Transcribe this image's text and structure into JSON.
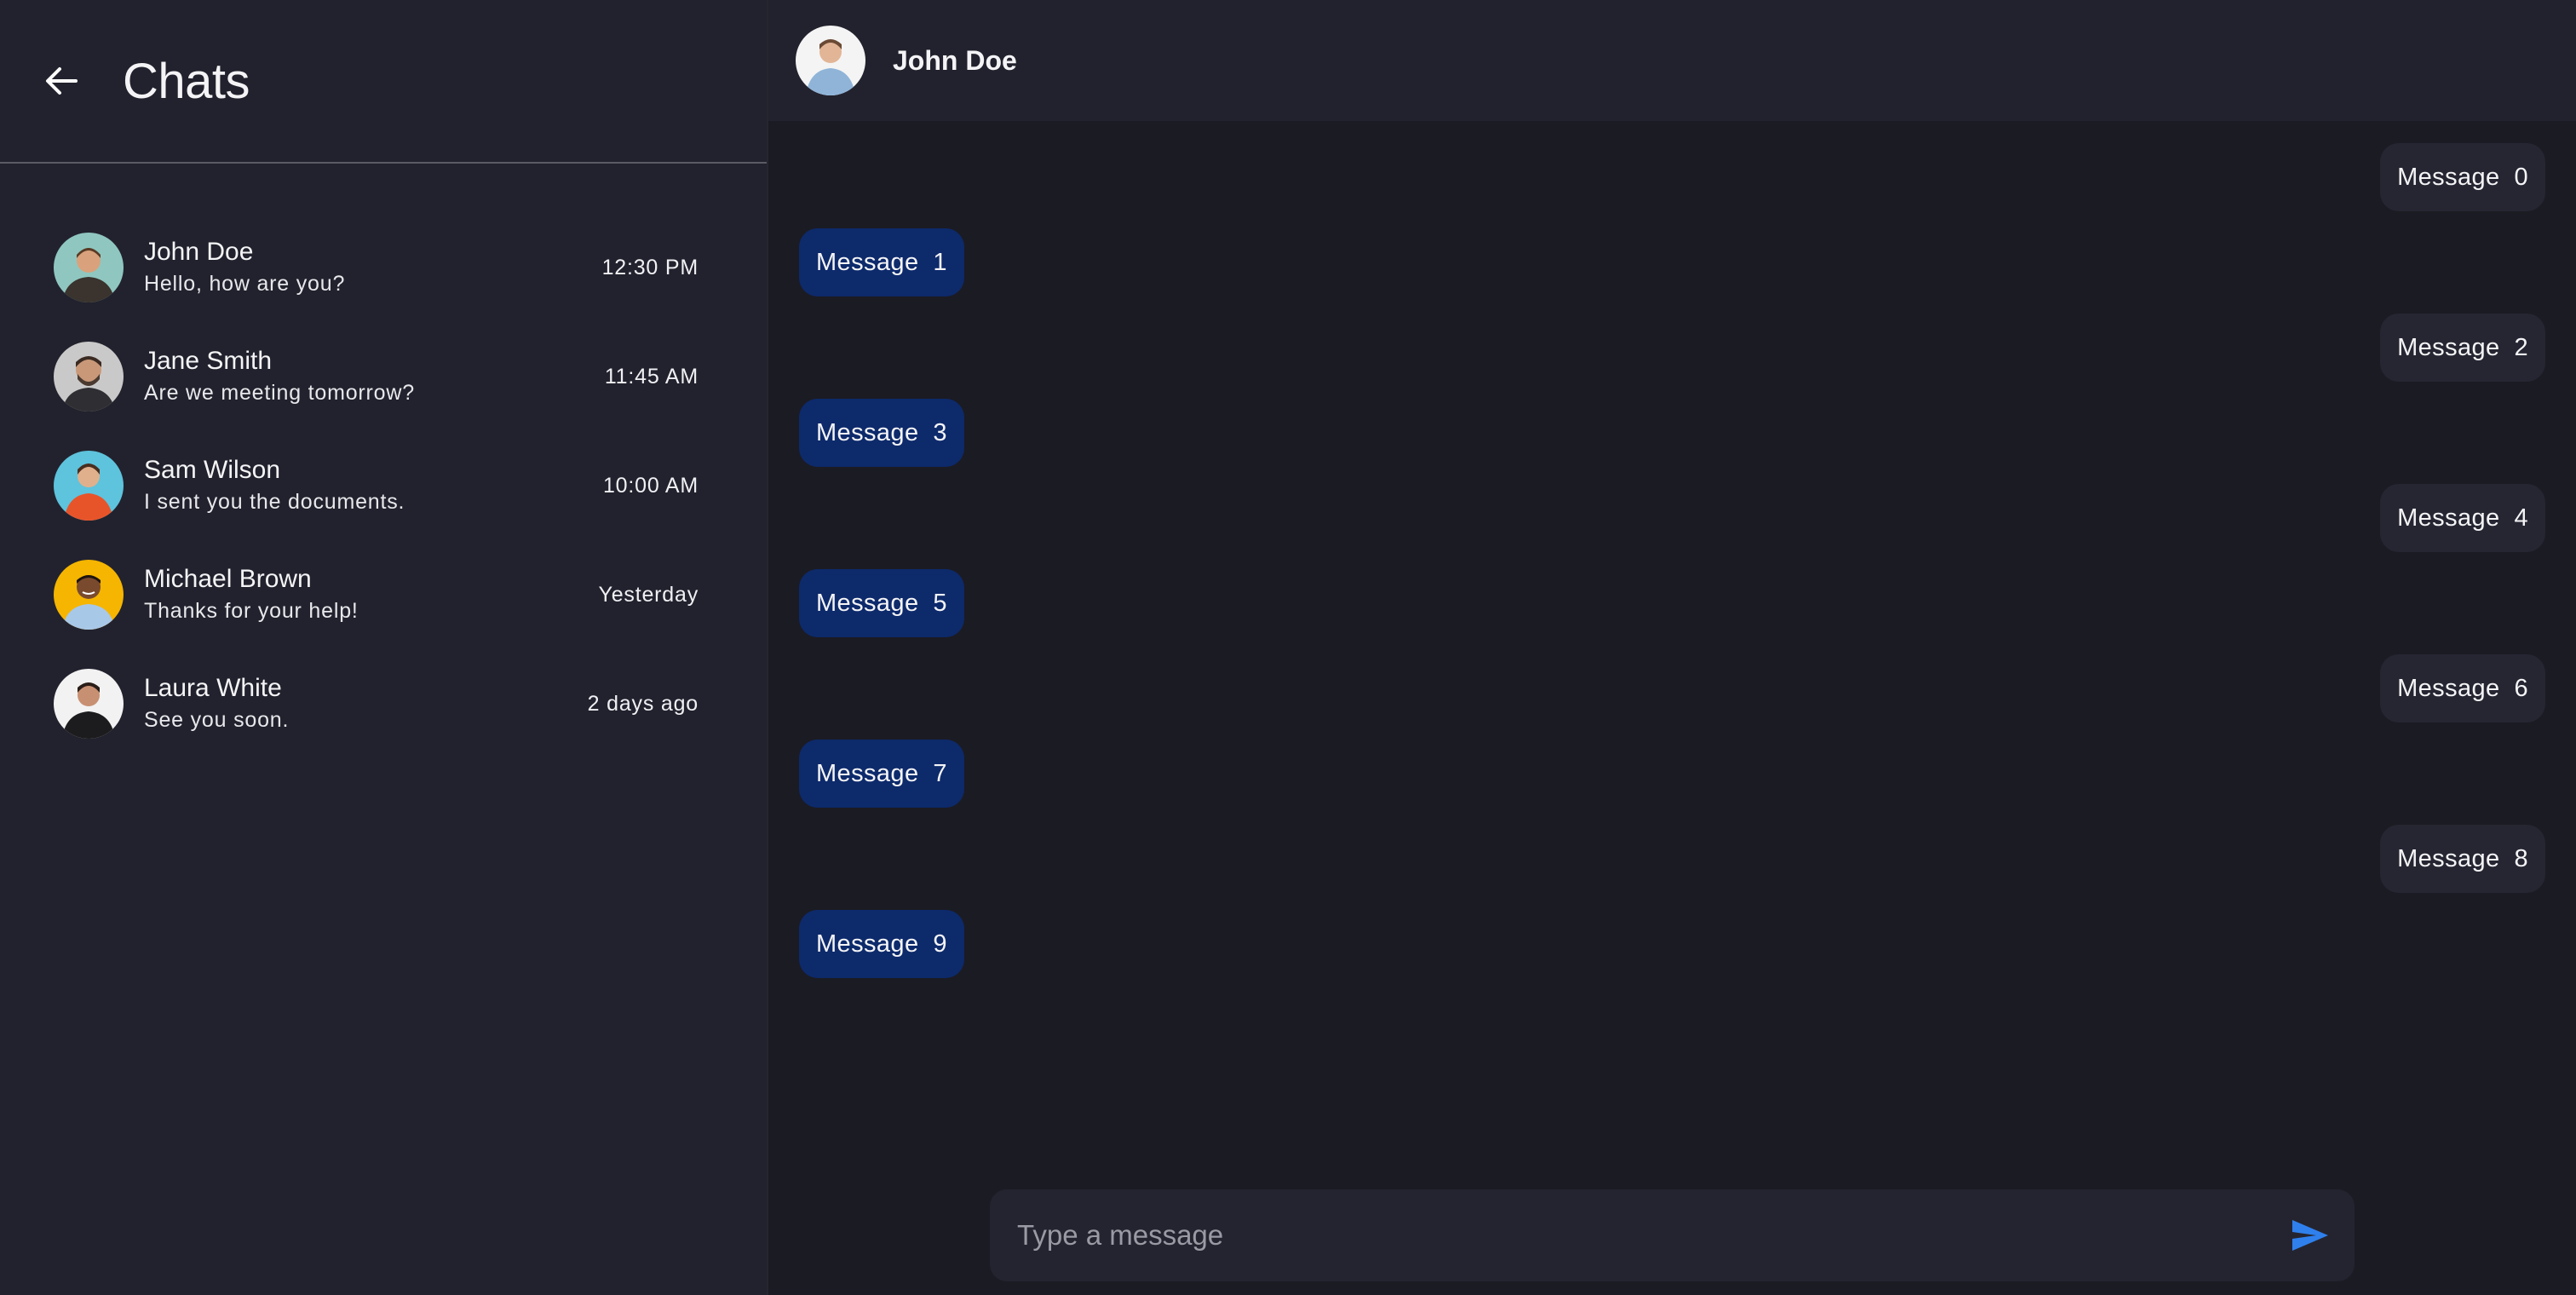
{
  "sidebar": {
    "title": "Chats",
    "chats": [
      {
        "name": "John Doe",
        "preview": "Hello, how are you?",
        "time": "12:30 PM"
      },
      {
        "name": "Jane Smith",
        "preview": "Are we meeting tomorrow?",
        "time": "11:45 AM"
      },
      {
        "name": "Sam Wilson",
        "preview": "I sent you the documents.",
        "time": "10:00 AM"
      },
      {
        "name": "Michael Brown",
        "preview": "Thanks for your help!",
        "time": "Yesterday"
      },
      {
        "name": "Laura White",
        "preview": "See you soon.",
        "time": "2 days ago"
      }
    ]
  },
  "conversation": {
    "contact_name": "John Doe",
    "messages": [
      {
        "text": "Message  0",
        "direction": "incoming"
      },
      {
        "text": "Message  1",
        "direction": "outgoing"
      },
      {
        "text": "Message  2",
        "direction": "incoming"
      },
      {
        "text": "Message  3",
        "direction": "outgoing"
      },
      {
        "text": "Message  4",
        "direction": "incoming"
      },
      {
        "text": "Message  5",
        "direction": "outgoing"
      },
      {
        "text": "Message  6",
        "direction": "incoming"
      },
      {
        "text": "Message  7",
        "direction": "outgoing"
      },
      {
        "text": "Message  8",
        "direction": "incoming"
      },
      {
        "text": "Message  9",
        "direction": "outgoing"
      }
    ]
  },
  "composer": {
    "placeholder": "Type a message"
  },
  "colors": {
    "accent": "#2f80ed",
    "outgoing_bubble": "#0d2a6b",
    "incoming_bubble": "#262633",
    "sidebar_bg": "#22222e",
    "main_bg": "#1b1b23"
  }
}
